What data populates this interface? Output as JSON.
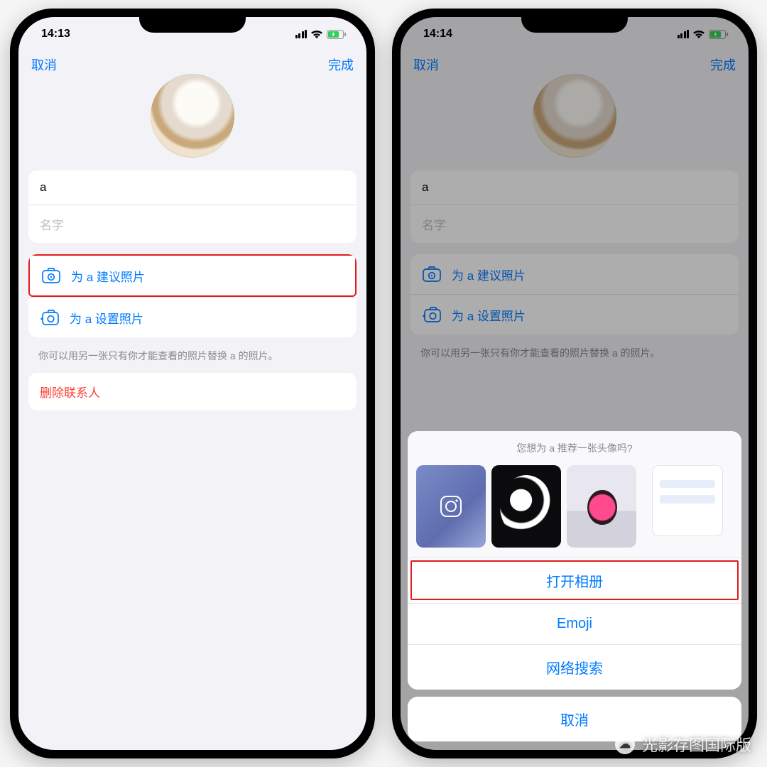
{
  "left": {
    "time": "14:13",
    "nav_cancel": "取消",
    "nav_done": "完成",
    "name_value": "a",
    "name_placeholder": "名字",
    "action1": "为 a 建议照片",
    "action2": "为 a 设置照片",
    "hint": "你可以用另一张只有你才能查看的照片替换 a 的照片。",
    "delete": "删除联系人"
  },
  "right": {
    "time": "14:14",
    "nav_cancel": "取消",
    "nav_done": "完成",
    "name_value": "a",
    "name_placeholder": "名字",
    "action1": "为 a 建议照片",
    "action2": "为 a 设置照片",
    "hint": "你可以用另一张只有你才能查看的照片替换 a 的照片。",
    "sheet_title": "您想为 a 推荐一张头像吗?",
    "open_album": "打开相册",
    "emoji": "Emoji",
    "web_search": "网络搜索",
    "cancel": "取消"
  },
  "watermark": "光影存图国际版"
}
